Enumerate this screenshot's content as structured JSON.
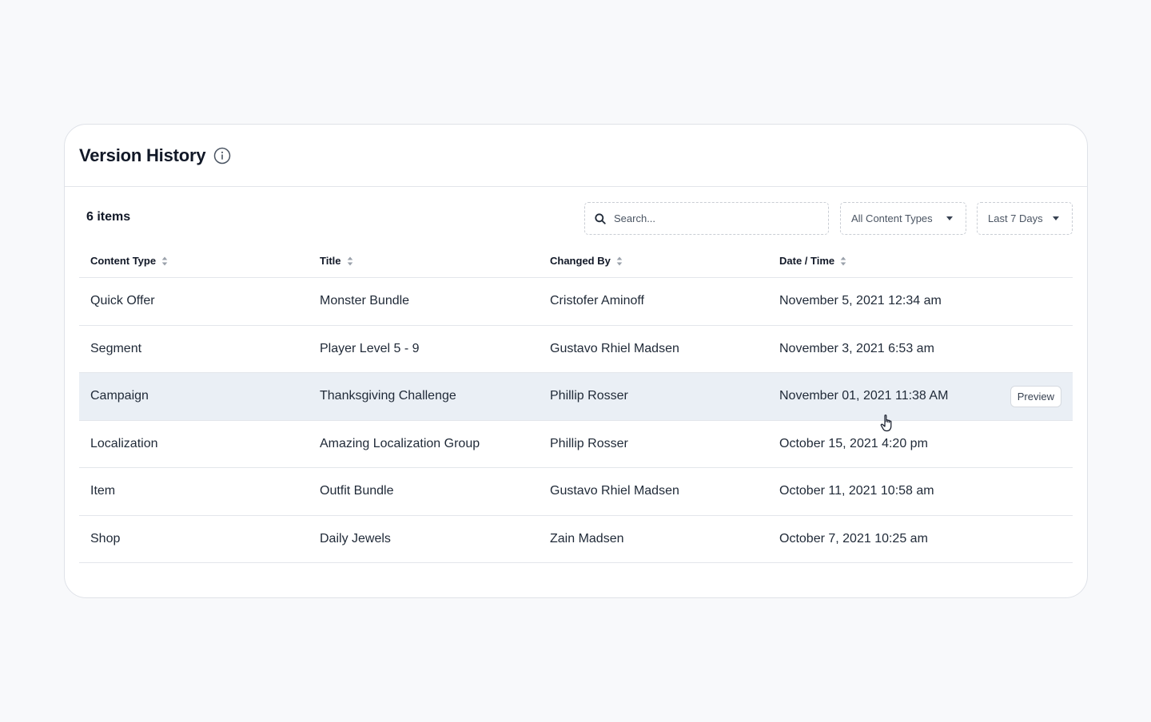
{
  "header": {
    "title": "Version History",
    "info_icon": "info-circle-icon"
  },
  "toolbar": {
    "item_count": "6 items",
    "search": {
      "placeholder": "Search...",
      "value": "",
      "icon": "search-icon"
    },
    "content_type_filter": {
      "selected": "All Content Types"
    },
    "date_filter": {
      "selected": "Last 7 Days"
    }
  },
  "table": {
    "columns": [
      "Content Type",
      "Title",
      "Changed By",
      "Date / Time"
    ],
    "rows": [
      {
        "content_type": "Quick Offer",
        "title": "Monster Bundle",
        "changed_by": "Cristofer Aminoff",
        "date": "November 5, 2021 12:34 am"
      },
      {
        "content_type": "Segment",
        "title": "Player Level 5 - 9",
        "changed_by": "Gustavo Rhiel Madsen",
        "date": "November 3, 2021 6:53 am"
      },
      {
        "content_type": "Campaign",
        "title": "Thanksgiving Challenge",
        "changed_by": "Phillip Rosser",
        "date": "November 01, 2021  11:38 AM"
      },
      {
        "content_type": "Localization",
        "title": "Amazing Localization Group",
        "changed_by": "Phillip Rosser",
        "date": "October 15, 2021 4:20 pm"
      },
      {
        "content_type": "Item",
        "title": "Outfit Bundle",
        "changed_by": "Gustavo Rhiel Madsen",
        "date": "October 11, 2021 10:58 am"
      },
      {
        "content_type": "Shop",
        "title": "Daily Jewels",
        "changed_by": "Zain Madsen",
        "date": "October 7, 2021 10:25 am"
      }
    ],
    "hovered_row_action": "Preview"
  },
  "colors": {
    "hover_row": "#eaeff5",
    "text": "#111827",
    "border": "#e3e6eb",
    "background": "#f8f9fb"
  }
}
